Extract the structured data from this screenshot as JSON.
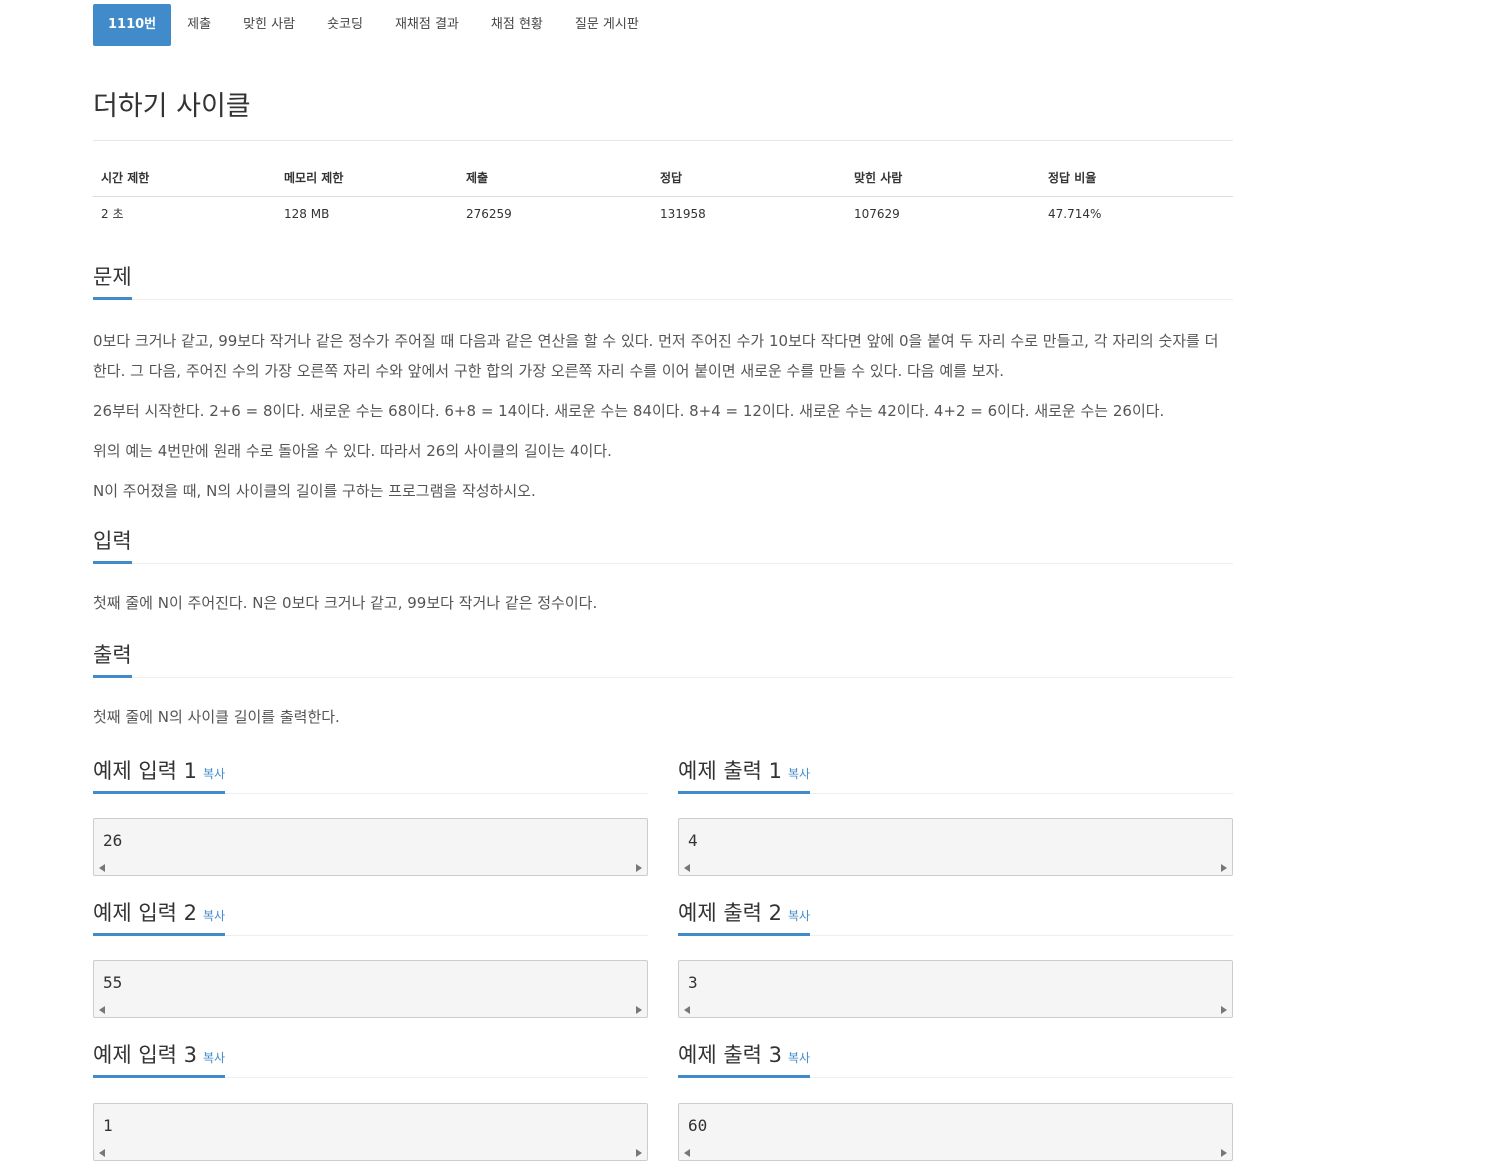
{
  "tabs": [
    {
      "label": "1110번",
      "active": true
    },
    {
      "label": "제출"
    },
    {
      "label": "맞힌 사람"
    },
    {
      "label": "숏코딩"
    },
    {
      "label": "재채점 결과"
    },
    {
      "label": "채점 현황"
    },
    {
      "label": "질문 게시판"
    }
  ],
  "title": "더하기 사이클",
  "info": {
    "headers": [
      "시간 제한",
      "메모리 제한",
      "제출",
      "정답",
      "맞힌 사람",
      "정답 비율"
    ],
    "values": [
      "2 초",
      "128 MB",
      "276259",
      "131958",
      "107629",
      "47.714%"
    ]
  },
  "problem": {
    "heading": "문제",
    "paragraphs": [
      "0보다 크거나 같고, 99보다 작거나 같은 정수가 주어질 때 다음과 같은 연산을 할 수 있다. 먼저 주어진 수가 10보다 작다면 앞에 0을 붙여 두 자리 수로 만들고, 각 자리의 숫자를 더한다. 그 다음, 주어진 수의 가장 오른쪽 자리 수와 앞에서 구한 합의 가장 오른쪽 자리 수를 이어 붙이면 새로운 수를 만들 수 있다. 다음 예를 보자.",
      "26부터 시작한다. 2+6 = 8이다. 새로운 수는 68이다. 6+8 = 14이다. 새로운 수는 84이다. 8+4 = 12이다. 새로운 수는 42이다. 4+2 = 6이다. 새로운 수는 26이다.",
      "위의 예는 4번만에 원래 수로 돌아올 수 있다. 따라서 26의 사이클의 길이는 4이다.",
      "N이 주어졌을 때, N의 사이클의 길이를 구하는 프로그램을 작성하시오."
    ]
  },
  "input": {
    "heading": "입력",
    "text": "첫째 줄에 N이 주어진다. N은 0보다 크거나 같고, 99보다 작거나 같은 정수이다."
  },
  "output": {
    "heading": "출력",
    "text": "첫째 줄에 N의 사이클 길이를 출력한다."
  },
  "copy_label": "복사",
  "samples": [
    {
      "in_title": "예제 입력 1",
      "in_value": "26",
      "out_title": "예제 출력 1",
      "out_value": "4"
    },
    {
      "in_title": "예제 입력 2",
      "in_value": "55",
      "out_title": "예제 출력 2",
      "out_value": "3"
    },
    {
      "in_title": "예제 입력 3",
      "in_value": "1",
      "out_title": "예제 출력 3",
      "out_value": "60"
    }
  ],
  "colors": {
    "accent": "#428bca",
    "text": "#333333",
    "muted": "#555555"
  }
}
